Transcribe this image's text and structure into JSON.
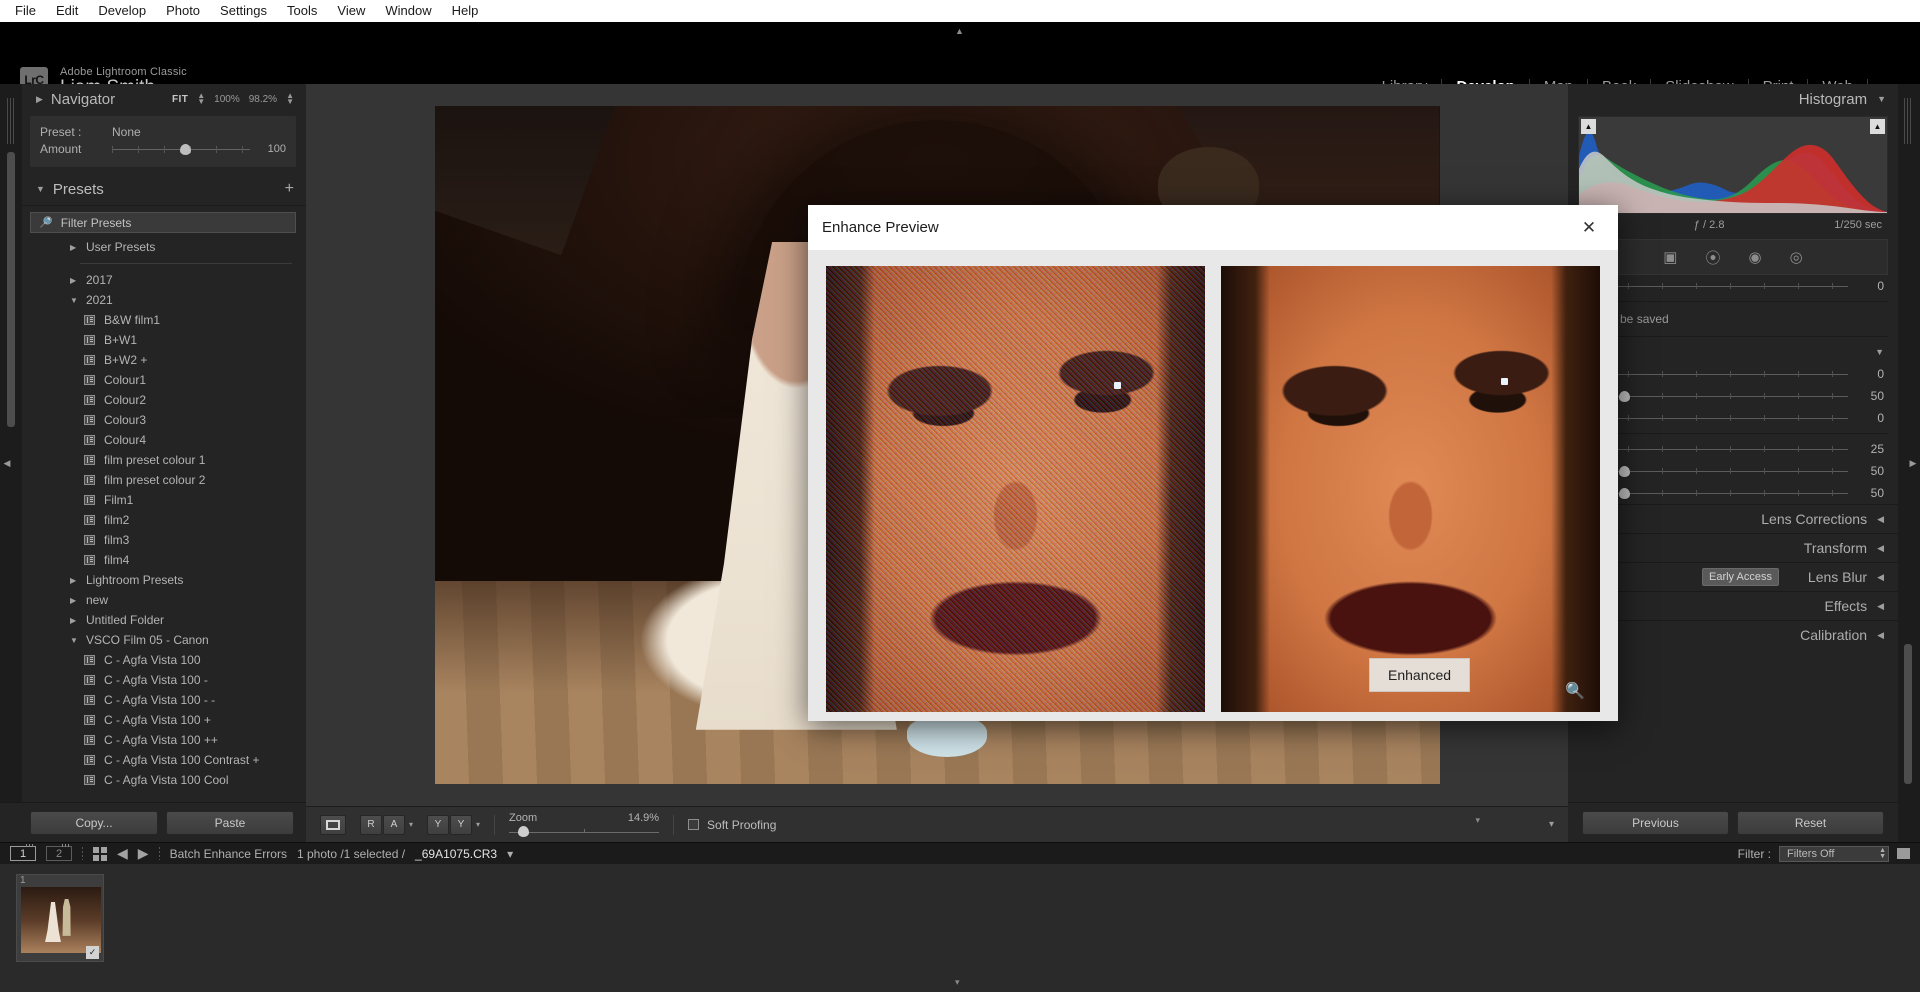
{
  "menubar": {
    "items": [
      "File",
      "Edit",
      "Develop",
      "Photo",
      "Settings",
      "Tools",
      "View",
      "Window",
      "Help"
    ]
  },
  "identity": {
    "logo_text": "LrC",
    "app_name": "Adobe Lightroom Classic",
    "user_name": "Liam Smith",
    "caret": "▼"
  },
  "modules": {
    "items": [
      "Library",
      "Develop",
      "Map",
      "Book",
      "Slideshow",
      "Print",
      "Web"
    ],
    "active": "Develop",
    "cloud_icon": "cloud-icon"
  },
  "left_panel": {
    "navigator": {
      "title": "Navigator",
      "triangle": "▶",
      "fit_label": "FIT",
      "zoom_100": "100%",
      "zoom_fit_pct": "98.2%"
    },
    "preset_preview": {
      "preset_label": "Preset :",
      "preset_value": "None",
      "amount_label": "Amount",
      "amount_value": "100"
    },
    "presets": {
      "title": "Presets",
      "triangle": "▼",
      "add_icon": "+",
      "filter_placeholder": "Filter Presets",
      "search_icon": "search-icon",
      "groups": [
        {
          "label": "User Presets",
          "expanded": false,
          "items": []
        },
        {
          "label": "2017",
          "expanded": false,
          "items": []
        },
        {
          "label": "2021",
          "expanded": true,
          "items": [
            "B&W film1",
            "B+W1",
            "B+W2  +",
            "Colour1",
            "Colour2",
            "Colour3",
            "Colour4",
            "film preset colour 1",
            "film preset colour 2",
            "Film1",
            "film2",
            "film3",
            "film4"
          ]
        },
        {
          "label": "Lightroom Presets",
          "expanded": false,
          "items": []
        },
        {
          "label": "new",
          "expanded": false,
          "items": []
        },
        {
          "label": "Untitled Folder",
          "expanded": false,
          "items": []
        },
        {
          "label": "VSCO Film 05 - Canon",
          "expanded": true,
          "items": [
            "C - Agfa Vista 100",
            "C - Agfa Vista 100 -",
            "C - Agfa Vista 100 - -",
            "C - Agfa Vista 100 +",
            "C - Agfa Vista 100 ++",
            "C - Agfa Vista 100 Contrast +",
            "C - Agfa Vista 100 Cool"
          ]
        }
      ]
    },
    "copy_label": "Copy...",
    "paste_label": "Paste"
  },
  "right_panel": {
    "histogram": {
      "title": "Histogram",
      "triangle": "▼",
      "aperture": "ƒ / 2.8",
      "shutter": "1/250 sec"
    },
    "tools": [
      "crop-icon",
      "spot-removal-icon",
      "red-eye-icon",
      "masking-icon"
    ],
    "slider_rows_top": [
      {
        "value": "0"
      }
    ],
    "note_text": "ult will be saved",
    "detail_triangle": "▼",
    "slider_rows": [
      {
        "value": "0"
      },
      {
        "value": "50"
      },
      {
        "value": "0"
      },
      {
        "value": "25"
      },
      {
        "value": "50"
      },
      {
        "value": "50"
      }
    ],
    "sections": [
      {
        "label": "Lens Corrections",
        "triangle": "◀",
        "badge": ""
      },
      {
        "label": "Transform",
        "triangle": "◀",
        "badge": ""
      },
      {
        "label": "Lens Blur",
        "triangle": "◀",
        "badge": "Early Access"
      },
      {
        "label": "Effects",
        "triangle": "◀",
        "badge": ""
      },
      {
        "label": "Calibration",
        "triangle": "◀",
        "badge": ""
      }
    ],
    "previous_label": "Previous",
    "reset_label": "Reset"
  },
  "toolbar": {
    "view_loupe_icon": "loupe-view-icon",
    "compare_icons": [
      "R",
      "A"
    ],
    "survey_icons": [
      "Y",
      "Y"
    ],
    "caret": "▾",
    "zoom_label": "Zoom",
    "zoom_value": "14.9%",
    "soft_proofing_label": "Soft Proofing",
    "soft_proofing_checked": false,
    "right_caret": "▾"
  },
  "filmstrip_bar": {
    "screen1": "1",
    "screen2": "2",
    "grid_icon": "grid-view-icon",
    "back_arrow": "◀",
    "forward_arrow": "▶",
    "status_text": "Batch Enhance Errors",
    "count_text": "1 photo /1 selected /",
    "file_name": "_69A1075.CR3",
    "file_caret": "▾",
    "filter_label": "Filter :",
    "filter_value": "Filters Off",
    "stepper": "▲▼"
  },
  "filmstrip": {
    "thumbnail_index": "1",
    "badge": "✓"
  },
  "dialog": {
    "title": "Enhance Preview",
    "close_icon": "close-icon",
    "left_pane_label": "original-noisy-preview",
    "right_pane_label": "enhanced-preview",
    "enhanced_chip": "Enhanced",
    "zoom_out_icon": "zoom-out-icon"
  }
}
